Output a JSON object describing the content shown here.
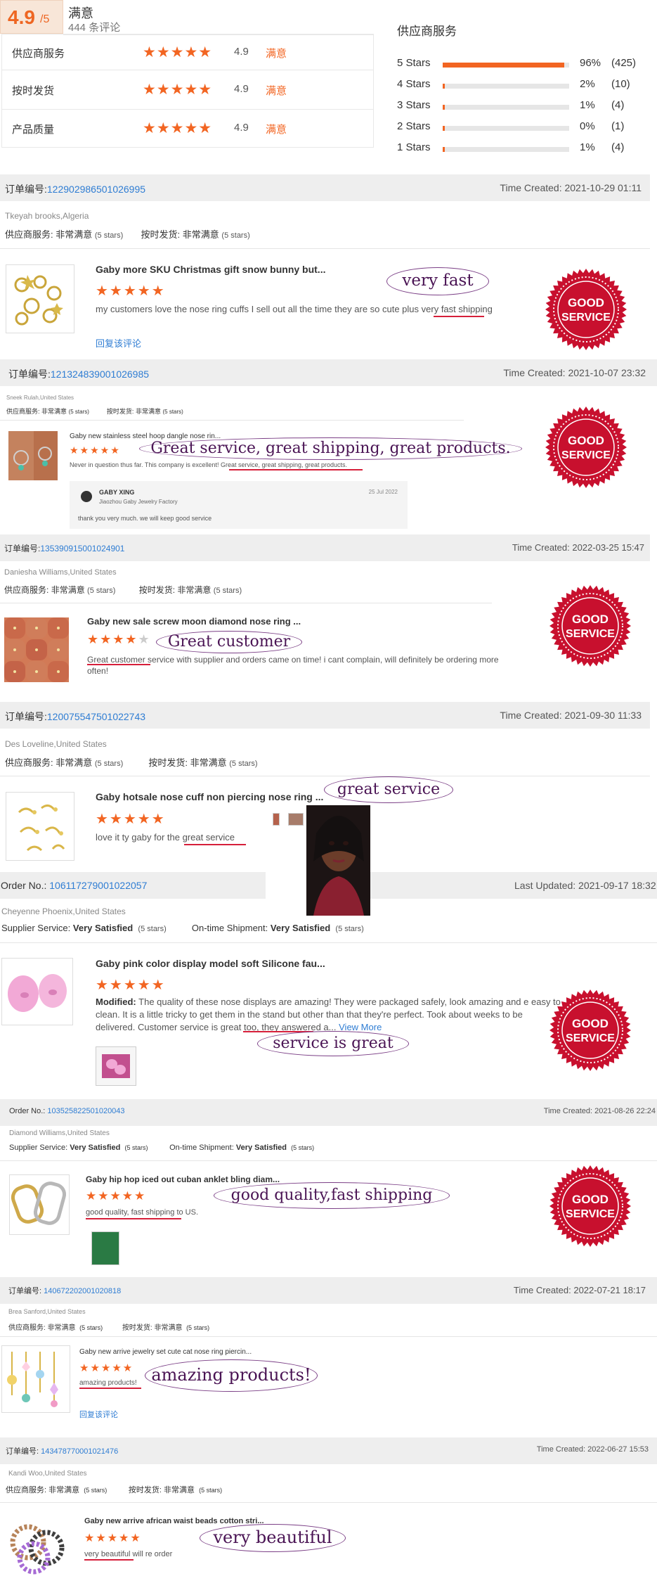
{
  "summary": {
    "score": "4.9",
    "score_suffix": "/5",
    "label": "满意",
    "review_count": "444 条评论",
    "metrics": [
      {
        "name": "供应商服务",
        "stars": "★★★★★",
        "value": "4.9",
        "word": "满意"
      },
      {
        "name": "按时发货",
        "stars": "★★★★★",
        "value": "4.9",
        "word": "满意"
      },
      {
        "name": "产品质量",
        "stars": "★★★★★",
        "value": "4.9",
        "word": "满意"
      }
    ],
    "supplier_title": "供应商服务",
    "distribution": [
      {
        "label": "5 Stars",
        "percent": 96,
        "pct_text": "96%",
        "count": "(425)"
      },
      {
        "label": "4 Stars",
        "percent": 2,
        "pct_text": "2%",
        "count": "(10)"
      },
      {
        "label": "3 Stars",
        "percent": 1,
        "pct_text": "1%",
        "count": "(4)"
      },
      {
        "label": "2 Stars",
        "percent": 0,
        "pct_text": "0%",
        "count": "(1)"
      },
      {
        "label": "1 Stars",
        "percent": 1,
        "pct_text": "1%",
        "count": "(4)"
      }
    ]
  },
  "badge_text": [
    "GOOD",
    "SERVICE"
  ],
  "colors": {
    "accent": "#f26522",
    "link": "#2f7dd3",
    "badge_red": "#c8102e"
  },
  "reviews": [
    {
      "order_label": "订单编号:",
      "order_no": "122902986501026995",
      "time": "Time Created: 2021-10-29 01:11",
      "buyer": "Tkeyah brooks,Algeria",
      "svc1_label": "供应商服务:",
      "svc1_val": "非常满意",
      "svc1_stars": "(5 stars)",
      "svc2_label": "按时发货:",
      "svc2_val": "非常满意",
      "svc2_stars": "(5 stars)",
      "title": "Gaby more SKU Christmas gift snow bunny but...",
      "stars": "★★★★★",
      "text": "my customers love the nose ring cuffs I sell out all the time they are so cute plus very fast shipping",
      "reply": "回复该评论",
      "callout": "very fast"
    },
    {
      "order_label": "订单编号:",
      "order_no": "121324839001026985",
      "time": "Time Created: 2021-10-07 23:32",
      "buyer": "Sneek Rulah,United States",
      "svc1_label": "供应商服务:",
      "svc1_val": "非常满意",
      "svc1_stars": "(5 stars)",
      "svc2_label": "按时发货:",
      "svc2_val": "非常满意",
      "svc2_stars": "(5 stars)",
      "title": "Gaby new stainless steel hoop dangle nose rin...",
      "stars": "★★★★★",
      "text": "Never in question thus far. This company is excellent! Great service, great shipping, great products.",
      "callout": "Great service, great shipping, great products.",
      "reply_name": "GABY XING",
      "reply_company": "Jiaozhou Gaby Jewelry Factory",
      "reply_date": "25 Jul 2022",
      "reply_text": "thank you very much. we will keep good service"
    },
    {
      "order_label": "订单编号:",
      "order_no": "135390915001024901",
      "time": "Time Created: 2022-03-25 15:47",
      "buyer": "Daniesha Williams,United States",
      "svc1_label": "供应商服务:",
      "svc1_val": "非常满意",
      "svc1_stars": "(5 stars)",
      "svc2_label": "按时发货:",
      "svc2_val": "非常满意",
      "svc2_stars": "(5 stars)",
      "title": "Gaby new sale screw moon diamond nose ring ...",
      "stars": "★★★★",
      "stars_empty": "★",
      "text": "Great customer service with supplier and orders came on time! i cant complain, will definitely be ordering more often!",
      "callout": "Great customer"
    },
    {
      "order_label": "订单编号:",
      "order_no": "120075547501022743",
      "time": "Time Created: 2021-09-30 11:33",
      "buyer": "Des Loveline,United States",
      "svc1_label": "供应商服务:",
      "svc1_val": "非常满意",
      "svc1_stars": "(5 stars)",
      "svc2_label": "按时发货:",
      "svc2_val": "非常满意",
      "svc2_stars": "(5 stars)",
      "title": "Gaby hotsale nose cuff non piercing nose ring ...",
      "stars": "★★★★★",
      "text": "love it ty gaby for the great service",
      "callout": "great service"
    },
    {
      "order_label": "Order No.:",
      "order_no": "106117279001022057",
      "time": "Last Updated: 2021-09-17 18:32",
      "buyer": "Cheyenne Phoenix,United States",
      "svc1_label": "Supplier Service:",
      "svc1_val": "Very Satisfied",
      "svc1_stars": "(5 stars)",
      "svc2_label": "On-time Shipment:",
      "svc2_val": "Very Satisfied",
      "svc2_stars": "(5 stars)",
      "title": "Gaby pink color display model soft Silicone fau...",
      "stars": "★★★★★",
      "text_bold": "Modified:",
      "text": " The quality of these nose displays are amazing! They were packaged safely, look amazing and e easy to clean. It is a little tricky to get them in the stand but other than that they're perfect. Took about weeks to be delivered. Customer service is great too, they answered a...",
      "view_more": "View More",
      "callout": "service is great"
    },
    {
      "order_label": "Order No.:",
      "order_no": "103525822501020043",
      "time": "Time Created: 2021-08-26 22:24",
      "buyer": "Diamond Williams,United States",
      "svc1_label": "Supplier Service:",
      "svc1_val": "Very Satisfied",
      "svc1_stars": "(5 stars)",
      "svc2_label": "On-time Shipment:",
      "svc2_val": "Very Satisfied",
      "svc2_stars": "(5 stars)",
      "title": "Gaby hip hop iced out cuban anklet bling diam...",
      "stars": "★★★★★",
      "text": "good quality, fast shipping to US.",
      "callout": "good quality,fast shipping"
    },
    {
      "order_label": "订单编号:",
      "order_no": "140672202001020818",
      "time": "Time Created: 2022-07-21 18:17",
      "buyer": "Brea Sanford,United States",
      "svc1_label": "供应商服务:",
      "svc1_val": "非常满意",
      "svc1_stars": "(5 stars)",
      "svc2_label": "按时发货:",
      "svc2_val": "非常满意",
      "svc2_stars": "(5 stars)",
      "title": "Gaby new arrive jewelry set cute cat nose ring piercin...",
      "stars": "★★★★★",
      "text": "amazing products!",
      "reply": "回复该评论",
      "callout": "amazing products!"
    },
    {
      "order_label": "订单编号:",
      "order_no": "143478770001021476",
      "time": "Time Created: 2022-06-27 15:53",
      "buyer": "Kandi Woo,United States",
      "svc1_label": "供应商服务:",
      "svc1_val": "非常满意",
      "svc1_stars": "(5 stars)",
      "svc2_label": "按时发货:",
      "svc2_val": "非常满意",
      "svc2_stars": "(5 stars)",
      "title": "Gaby new arrive african waist beads cotton stri...",
      "stars": "★★★★★",
      "text": "very beautiful will re order",
      "callout": "very beautiful"
    }
  ]
}
